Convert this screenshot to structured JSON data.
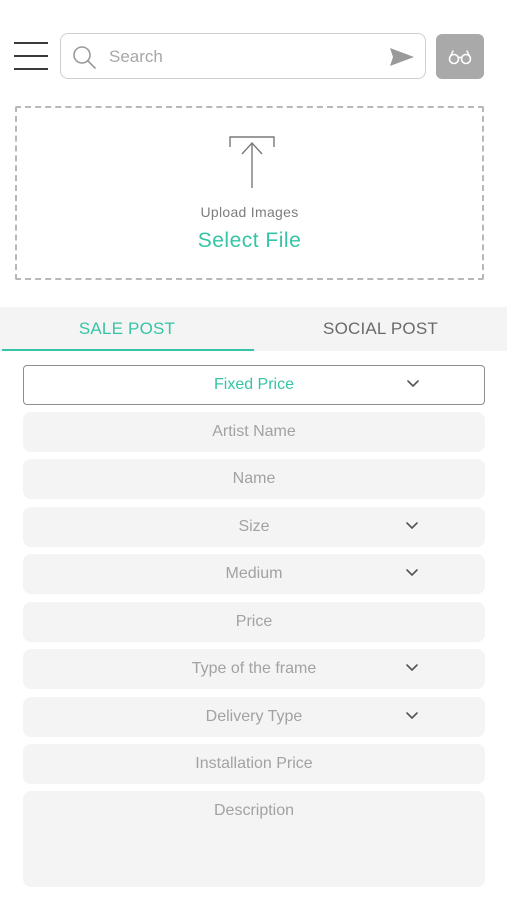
{
  "header": {
    "search_placeholder": "Search"
  },
  "upload": {
    "label": "Upload Images",
    "action": "Select File"
  },
  "tabs": [
    {
      "label": "SALE POST",
      "active": true
    },
    {
      "label": "SOCIAL POST",
      "active": false
    }
  ],
  "fields": {
    "price_type": "Fixed Price",
    "artist_name": "Artist Name",
    "name": "Name",
    "size": "Size",
    "medium": "Medium",
    "price": "Price",
    "frame_type": "Type of the frame",
    "delivery_type": "Delivery Type",
    "installation_price": "Installation Price",
    "description": "Description"
  },
  "colors": {
    "accent": "#35c5a6",
    "field_bg": "#f4f4f4",
    "button_gray": "#a9a9a9"
  },
  "icons": [
    "menu-icon",
    "search-icon",
    "send-icon",
    "glasses-icon",
    "upload-icon",
    "chevron-down-icon"
  ]
}
